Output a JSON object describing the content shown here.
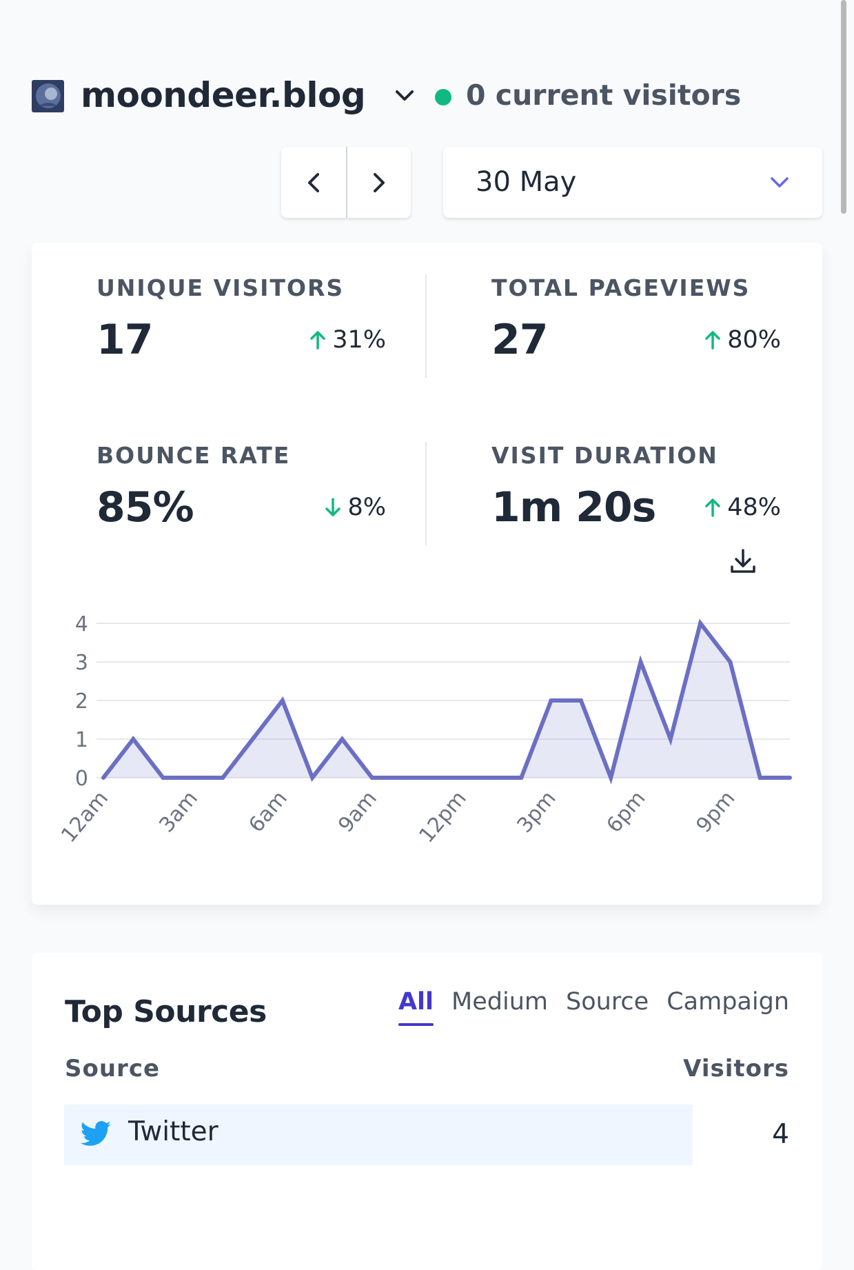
{
  "header": {
    "site_name": "moondeer.blog",
    "current_visitors": "0 current visitors",
    "live_color": "#10b981"
  },
  "period": {
    "prev_icon": "chevron-left-icon",
    "next_icon": "chevron-right-icon",
    "date_label": "30 May"
  },
  "stats": [
    {
      "label": "UNIQUE VISITORS",
      "value": "17",
      "change": "31%",
      "direction": "up"
    },
    {
      "label": "TOTAL PAGEVIEWS",
      "value": "27",
      "change": "80%",
      "direction": "up"
    },
    {
      "label": "BOUNCE RATE",
      "value": "85%",
      "change": "8%",
      "direction": "down"
    },
    {
      "label": "VISIT DURATION",
      "value": "1m 20s",
      "change": "48%",
      "direction": "up"
    }
  ],
  "colors": {
    "accent": "#6b6fc4",
    "accent_fill": "rgba(107,111,196,0.16)",
    "up": "#10b981",
    "down": "#10b981",
    "tab_active": "#4338ca"
  },
  "chart_data": {
    "type": "area",
    "x": [
      "12am",
      "1am",
      "2am",
      "3am",
      "4am",
      "5am",
      "6am",
      "7am",
      "8am",
      "9am",
      "10am",
      "11am",
      "12pm",
      "1pm",
      "2pm",
      "3pm",
      "4pm",
      "5pm",
      "6pm",
      "7pm",
      "8pm",
      "9pm",
      "10pm",
      "11pm"
    ],
    "xtick_labels": [
      "12am",
      "3am",
      "6am",
      "9am",
      "12pm",
      "3pm",
      "6pm",
      "9pm"
    ],
    "series": [
      {
        "values": [
          0,
          1,
          0,
          0,
          0,
          1,
          2,
          0,
          1,
          0,
          0,
          0,
          0,
          0,
          0,
          2,
          2,
          0,
          3,
          1,
          4,
          3,
          0,
          0
        ]
      }
    ],
    "yticks": [
      0,
      1,
      2,
      3,
      4
    ],
    "ylim": [
      0,
      4
    ],
    "grid": true
  },
  "sources": {
    "title": "Top Sources",
    "tabs": [
      "All",
      "Medium",
      "Source",
      "Campaign"
    ],
    "active_tab": "All",
    "col_source": "Source",
    "col_visitors": "Visitors",
    "rows": [
      {
        "name": "Twitter",
        "icon": "twitter-icon",
        "visitors": "4"
      }
    ]
  }
}
